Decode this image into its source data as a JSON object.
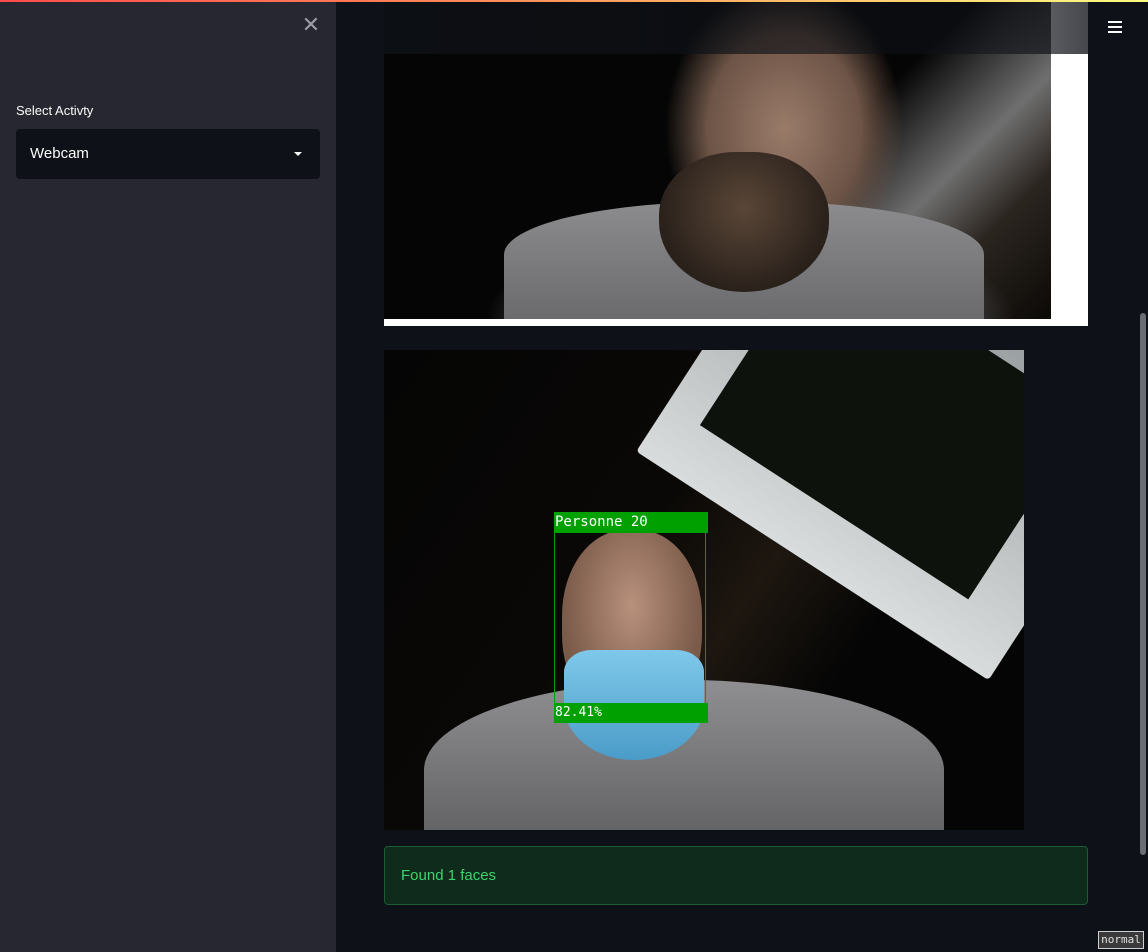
{
  "sidebar": {
    "close_icon": "close-icon",
    "select_label": "Select Activty",
    "select_value": "Webcam"
  },
  "header": {
    "menu_icon": "hamburger-menu-icon"
  },
  "main": {
    "detection": {
      "box_label": "Personne 20",
      "confidence": "82.41%"
    },
    "status_message": "Found 1 faces",
    "mode_badge": "normal"
  },
  "colors": {
    "sidebar_bg": "#262730",
    "main_bg": "#0e1117",
    "detection_box": "#00a000",
    "success_text": "#3dd56d",
    "success_bg": "#0f2b1c"
  }
}
